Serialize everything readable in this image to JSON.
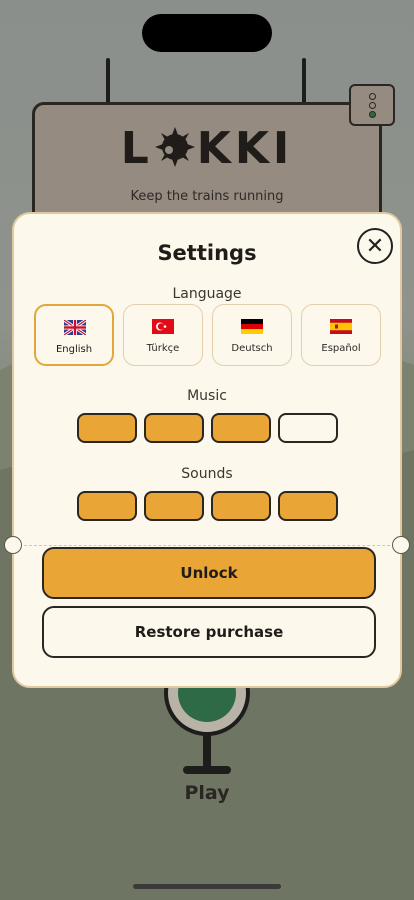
{
  "background": {
    "brand": "LOKKI",
    "logo_left": "L",
    "logo_right": "KKI",
    "tagline": "Keep the trains running",
    "play_label": "Play"
  },
  "settings": {
    "title": "Settings",
    "language_label": "Language",
    "languages": [
      {
        "label": "English",
        "selected": true
      },
      {
        "label": "Türkçe",
        "selected": false
      },
      {
        "label": "Deutsch",
        "selected": false
      },
      {
        "label": "Español",
        "selected": false
      }
    ],
    "music_label": "Music",
    "music_level": 3,
    "music_max": 4,
    "sounds_label": "Sounds",
    "sounds_level": 4,
    "sounds_max": 4,
    "unlock_label": "Unlock",
    "restore_label": "Restore purchase"
  },
  "colors": {
    "accent": "#e9a536",
    "panel": "#fdf8ec",
    "signal_green": "#2e6a45"
  }
}
